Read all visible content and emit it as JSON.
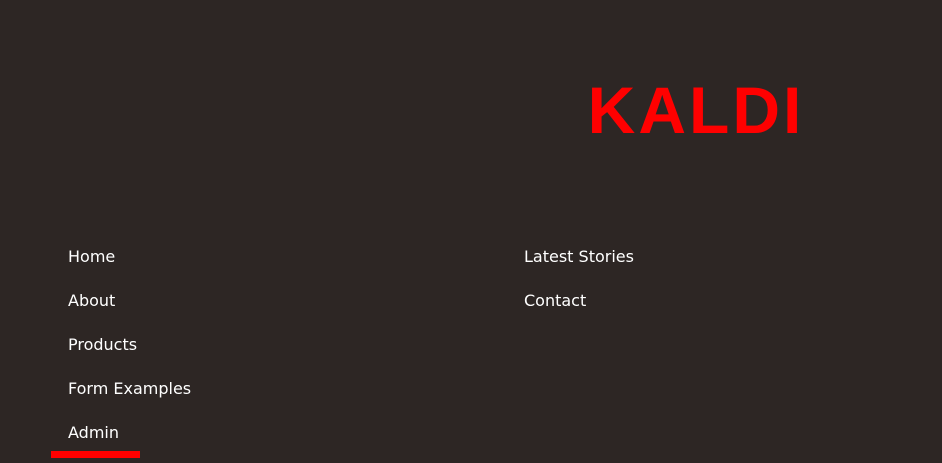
{
  "brand": {
    "logo_text": "KALDI",
    "accent_color": "#ff0000",
    "background_color": "#2d2624"
  },
  "nav": {
    "left": [
      {
        "label": "Home"
      },
      {
        "label": "About"
      },
      {
        "label": "Products"
      },
      {
        "label": "Form Examples"
      },
      {
        "label": "Admin",
        "active": true
      }
    ],
    "right": [
      {
        "label": "Latest Stories"
      },
      {
        "label": "Contact"
      }
    ]
  }
}
